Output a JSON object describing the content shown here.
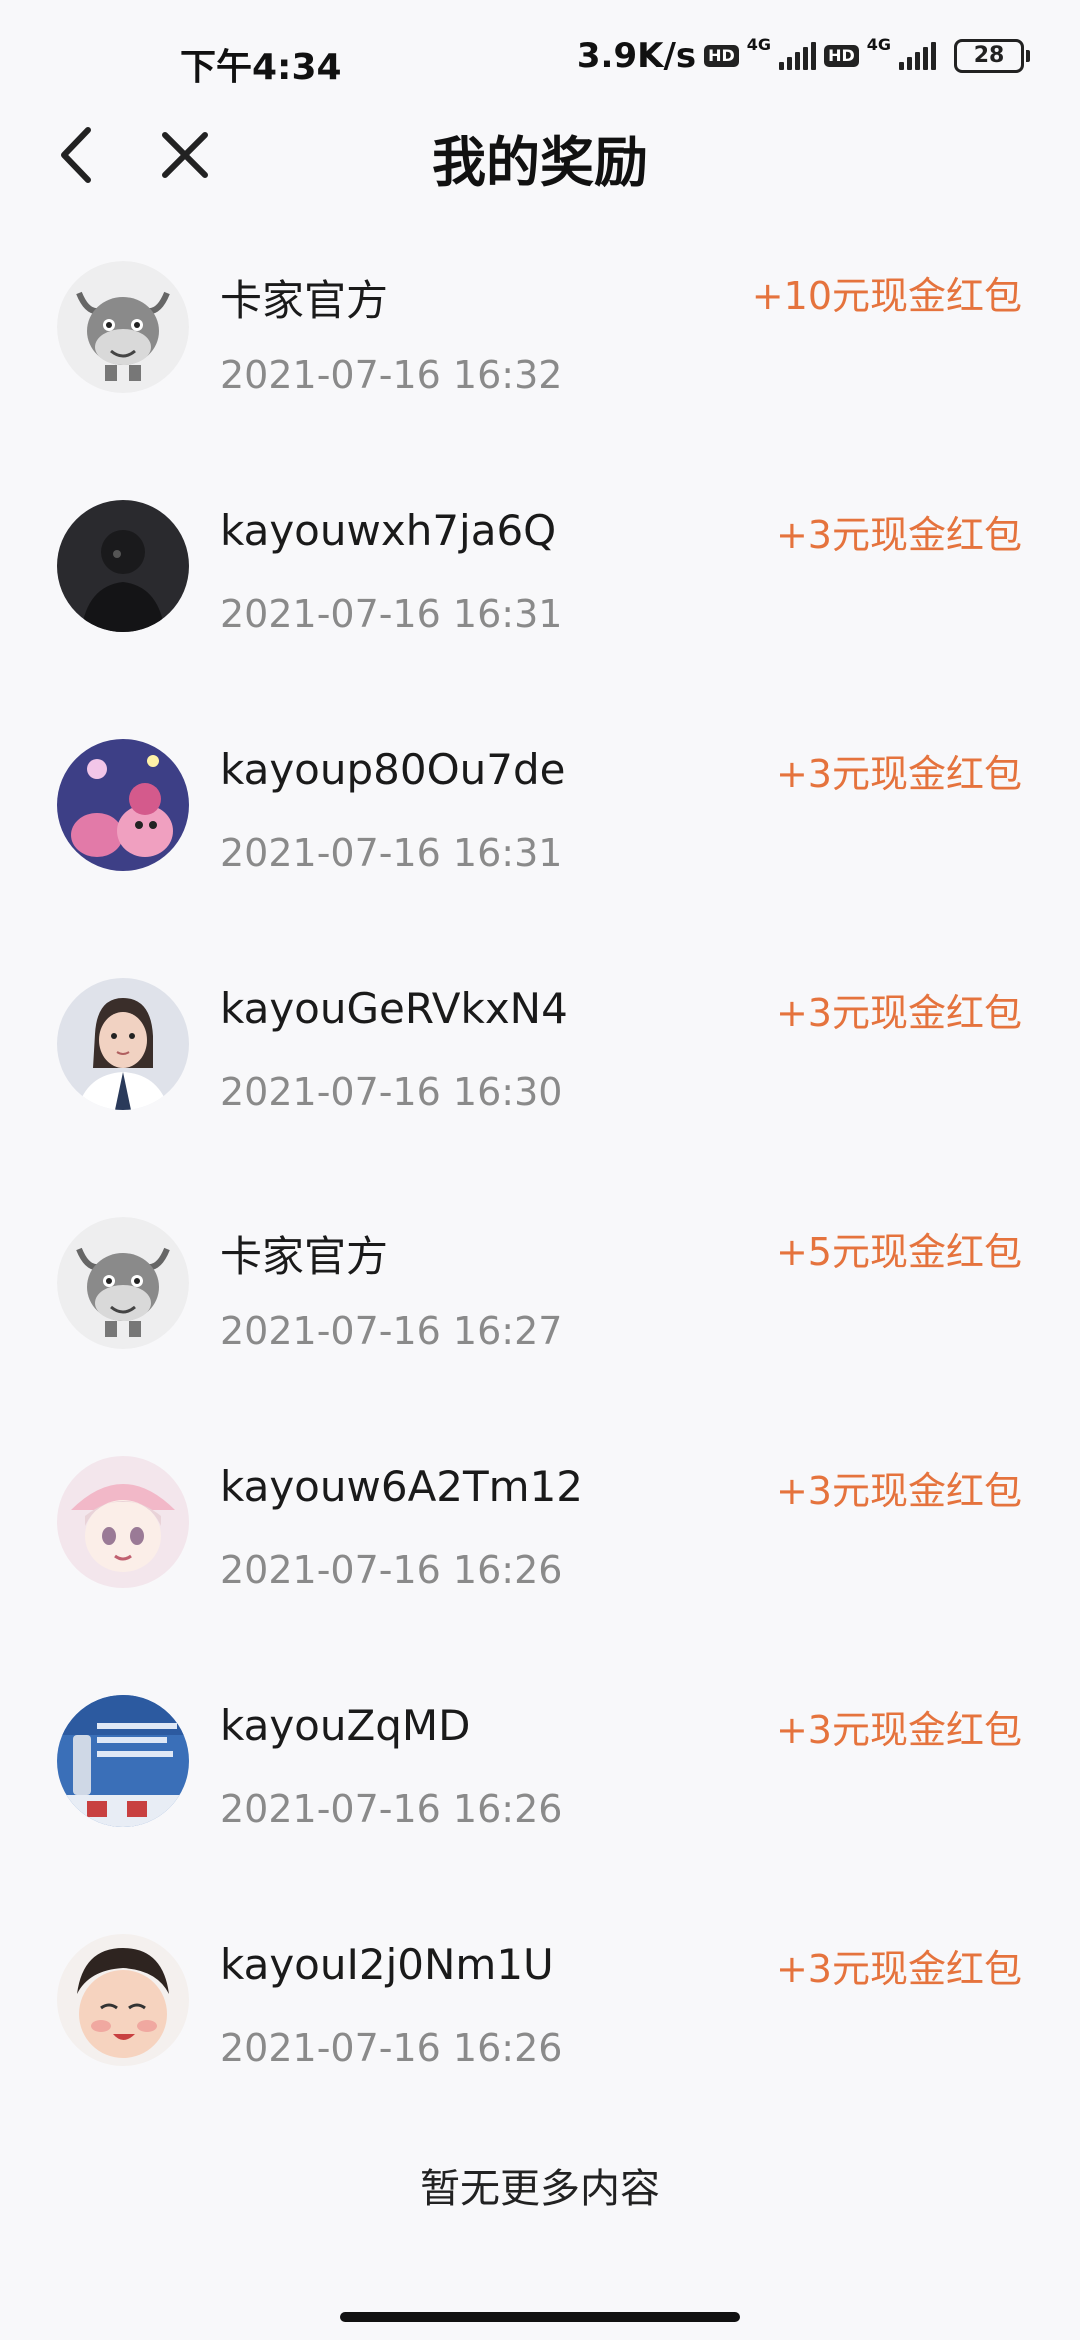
{
  "status_bar": {
    "time": "下午4:34",
    "network_speed": "3.9K/s",
    "hd_label": "HD",
    "network_type": "4G",
    "battery_level": "28"
  },
  "header": {
    "title": "我的奖励"
  },
  "rewards": [
    {
      "name": "卡家官方",
      "time": "2021-07-16 16:32",
      "amount": "+10元现金红包",
      "avatar": "cow-mascot-avatar"
    },
    {
      "name": "kayouwxh7ja6Q",
      "time": "2021-07-16 16:31",
      "amount": "+3元现金红包",
      "avatar": "dark-photo-avatar"
    },
    {
      "name": "kayoup80Ou7de",
      "time": "2021-07-16 16:31",
      "amount": "+3元现金红包",
      "avatar": "cartoon-avatar"
    },
    {
      "name": "kayouGeRVkxN4",
      "time": "2021-07-16 16:30",
      "amount": "+3元现金红包",
      "avatar": "woman-photo-avatar"
    },
    {
      "name": "卡家官方",
      "time": "2021-07-16 16:27",
      "amount": "+5元现金红包",
      "avatar": "cow-mascot-avatar"
    },
    {
      "name": "kayouw6A2Tm12",
      "time": "2021-07-16 16:26",
      "amount": "+3元现金红包",
      "avatar": "anime-girl-avatar"
    },
    {
      "name": "kayouZqMD",
      "time": "2021-07-16 16:26",
      "amount": "+3元现金红包",
      "avatar": "product-ad-avatar"
    },
    {
      "name": "kayouI2j0Nm1U",
      "time": "2021-07-16 16:26",
      "amount": "+3元现金红包",
      "avatar": "child-photo-avatar"
    }
  ],
  "footer": {
    "no_more_text": "暂无更多内容"
  },
  "colors": {
    "reward_accent": "#e5733d",
    "time_gray": "#8a8a8a",
    "background": "#f8f8fa"
  }
}
